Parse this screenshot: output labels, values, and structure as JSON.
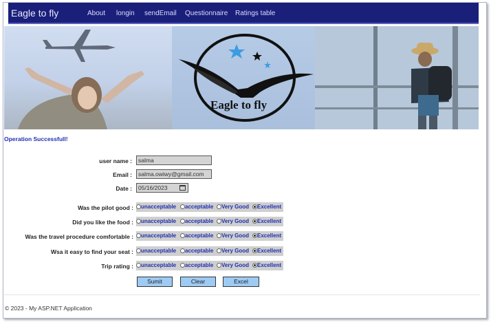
{
  "nav": {
    "brand": "Eagle to fly",
    "items": [
      "About",
      "longin",
      "sendEmail",
      "Questionnaire",
      "Ratings table"
    ]
  },
  "banner": {
    "logo_text": "Eagle to fly"
  },
  "message": "Operation Successfull!",
  "form": {
    "username_label": "user name :",
    "username_value": "salma",
    "email_label": "Email :",
    "email_value": "salma.owiwy@gmail.com",
    "date_label": "Date :",
    "date_value": "05/16/2023"
  },
  "rating_options": [
    "unacceptable",
    "acceptable",
    "Very Good",
    "Excellent"
  ],
  "questions": [
    {
      "label": "Was the pilot good :",
      "selected": "Excellent"
    },
    {
      "label": "Did you like the food :",
      "selected": "Excellent"
    },
    {
      "label": "Was the travel procedure comfortable :",
      "selected": "Excellent"
    },
    {
      "label": "Wsa it easy to find your seat :",
      "selected": "Excellent"
    },
    {
      "label": "Trip rating :",
      "selected": "Excellent"
    }
  ],
  "buttons": {
    "submit": "Sumit",
    "clear": "Clear",
    "excel": "Excel"
  },
  "footer": "© 2023 - My ASP.NET Application",
  "colors": {
    "navbar": "#1a1f7a",
    "accent": "#1f2fb0",
    "button": "#9ecbf4"
  }
}
